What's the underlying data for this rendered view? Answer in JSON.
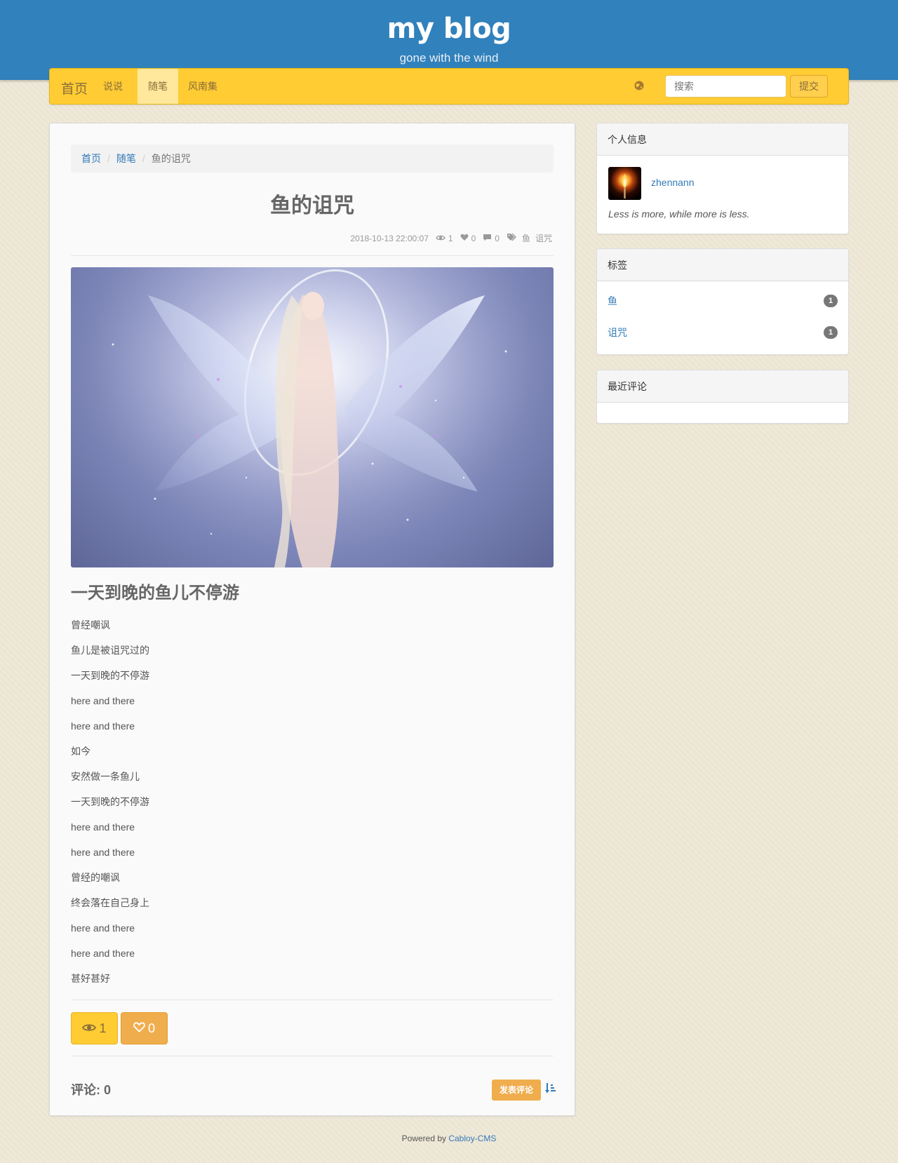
{
  "header": {
    "title": "my blog",
    "subtitle": "gone with the wind"
  },
  "navbar": {
    "brand": "首页",
    "items": [
      {
        "label": "说说",
        "active": false
      },
      {
        "label": "随笔",
        "active": true
      },
      {
        "label": "风南集",
        "active": false
      }
    ],
    "globe_icon": "globe-icon",
    "search": {
      "placeholder": "搜索",
      "value": ""
    },
    "submit_label": "提交"
  },
  "breadcrumb": {
    "home": "首页",
    "category": "随笔",
    "current": "鱼的诅咒"
  },
  "post": {
    "title": "鱼的诅咒",
    "meta": {
      "date": "2018-10-13 22:00:07",
      "views": "1",
      "likes": "0",
      "comments": "0",
      "tags": [
        "鱼",
        "诅咒"
      ]
    },
    "subtitle": "一天到晚的鱼儿不停游",
    "lines": [
      "曾经嘲讽",
      "鱼儿是被诅咒过的",
      "一天到晚的不停游",
      "here and there",
      "here and there",
      "如今",
      "安然做一条鱼儿",
      "一天到晚的不停游",
      "here and there",
      "here and there",
      "曾经的嘲讽",
      "终会落在自己身上",
      "here and there",
      "here and there",
      "甚好甚好"
    ],
    "views_btn": "1",
    "likes_btn": "0",
    "comments_label": "评论: 0",
    "comment_button": "发表评论"
  },
  "sidebar": {
    "profile": {
      "heading": "个人信息",
      "name": "zhennann",
      "motto": "Less is more, while more is less."
    },
    "tags": {
      "heading": "标签",
      "items": [
        {
          "label": "鱼",
          "count": "1"
        },
        {
          "label": "诅咒",
          "count": "1"
        }
      ]
    },
    "recent_comments": {
      "heading": "最近评论"
    }
  },
  "footer": {
    "prefix": "Powered by",
    "link": "Cabloy-CMS"
  },
  "colors": {
    "header": "#3181bc",
    "navbar": "#ffcc33",
    "accent": "#f0ad4e",
    "link": "#337ab7"
  }
}
